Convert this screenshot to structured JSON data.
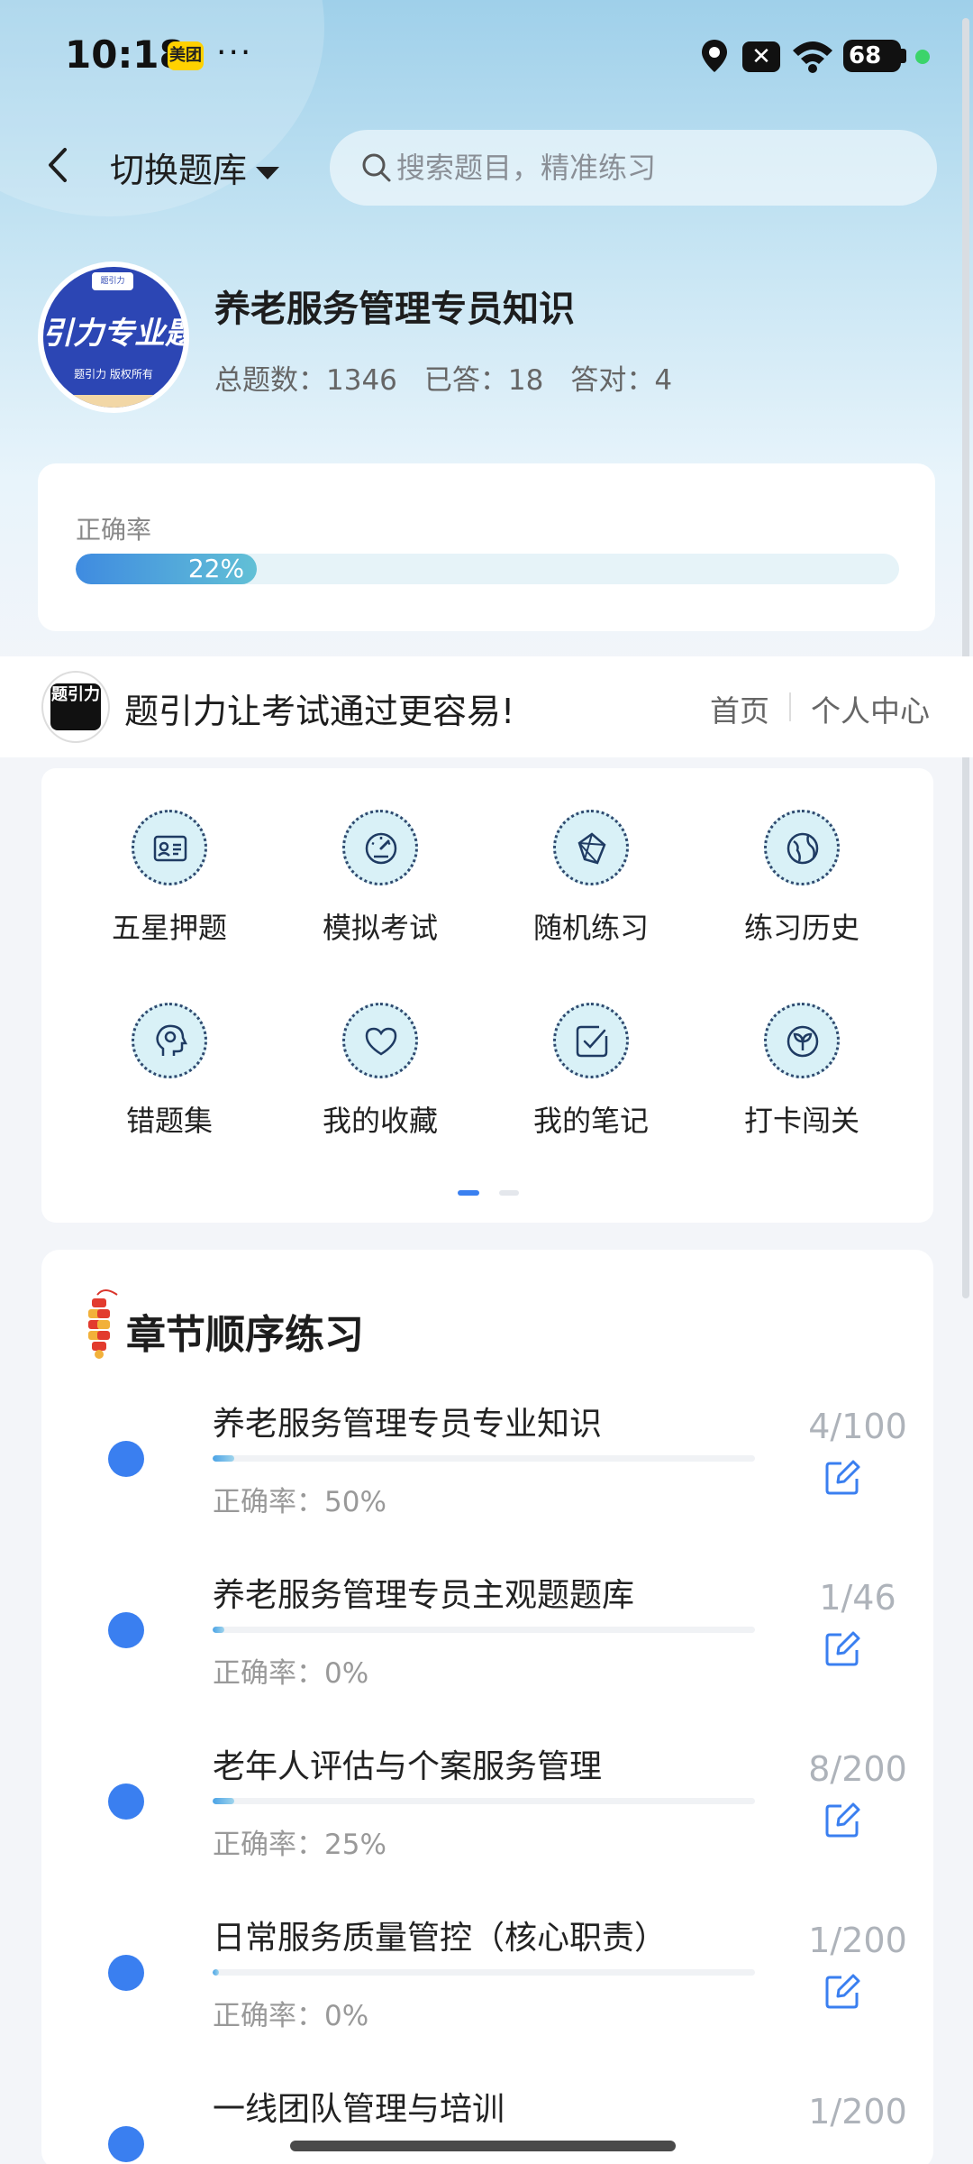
{
  "status_bar": {
    "time": "10:18",
    "meituan_badge": "美团",
    "more": "···",
    "battery": "68"
  },
  "header": {
    "switch_label": "切换题库",
    "search_placeholder": "搜索题目，精准练习"
  },
  "book": {
    "cover_big_text": "引力专业题",
    "cover_small_text": "题引力 版权所有",
    "cover_top_text": "题引力",
    "title": "养老服务管理专员知识",
    "stats": {
      "total": "总题数：1346",
      "answered": "已答：18",
      "correct": "答对：4"
    }
  },
  "accuracy": {
    "label": "正确率",
    "value_text": "22%",
    "value": 0.22
  },
  "banner": {
    "logo_text": "题引力",
    "slogan": "题引力让考试通过更容易!",
    "nav_home": "首页",
    "nav_profile": "个人中心"
  },
  "grid": {
    "items": [
      {
        "label": "五星押题",
        "icon": "id-card-icon"
      },
      {
        "label": "模拟考试",
        "icon": "gauge-icon"
      },
      {
        "label": "随机练习",
        "icon": "random-shape-icon"
      },
      {
        "label": "练习历史",
        "icon": "globe-icon"
      },
      {
        "label": "错题集",
        "icon": "head-icon"
      },
      {
        "label": "我的收藏",
        "icon": "heart-icon"
      },
      {
        "label": "我的笔记",
        "icon": "note-check-icon"
      },
      {
        "label": "打卡闯关",
        "icon": "sprout-icon"
      }
    ]
  },
  "chapters": {
    "title": "章节顺序练习",
    "items": [
      {
        "name": "养老服务管理专员专业知识",
        "accuracy": "正确率：50%",
        "count": "4/100",
        "progress": 0.04
      },
      {
        "name": "养老服务管理专员主观题题库",
        "accuracy": "正确率：0%",
        "count": "1/46",
        "progress": 0.0217
      },
      {
        "name": "老年人评估与个案服务管理",
        "accuracy": "正确率：25%",
        "count": "8/200",
        "progress": 0.04
      },
      {
        "name": "日常服务质量管控（核心职责）",
        "accuracy": "正确率：0%",
        "count": "1/200",
        "progress": 0.005
      },
      {
        "name": "一线团队管理与培训",
        "accuracy": "",
        "count": "1/200",
        "progress": 0.005
      }
    ]
  },
  "colors": {
    "accent": "#3a7ff0",
    "progress_track": "#e6f3f8",
    "icon_bg": "#d9f1f7"
  }
}
